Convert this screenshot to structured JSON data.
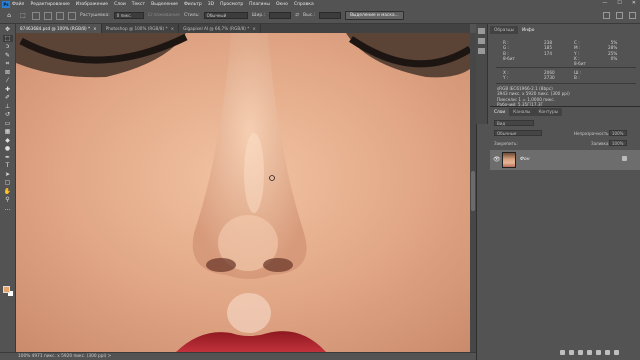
{
  "app": {
    "logo": "Ps"
  },
  "menu": [
    "Файл",
    "Редактирование",
    "Изображение",
    "Слои",
    "Текст",
    "Выделение",
    "Фильтр",
    "3D",
    "Просмотр",
    "Плагины",
    "Окно",
    "Справка"
  ],
  "window_controls": {
    "minimize": "—",
    "maximize": "☐",
    "close": "✕"
  },
  "options": {
    "feather_label": "Растушевка:",
    "feather_value": "0 пикс.",
    "antialias_label": "Сглаживание",
    "style_label": "Стиль:",
    "style_value": "Обычный",
    "width_label": "Шир.:",
    "height_label": "Выс.:",
    "select_mask_button": "Выделение и маска..."
  },
  "tabs": [
    {
      "label": "87463684.psd @ 100% (RGB/8) *",
      "close": "×"
    },
    {
      "label": "Photoshop @ 100% (RGB/8) *",
      "close": "×"
    },
    {
      "label": "Gigapixel AI @ 66,7% (RGB/8) *",
      "close": "×"
    }
  ],
  "info_panel": {
    "tabs": [
      "Образцы",
      "Инфо"
    ],
    "rgb_block": "R :\nG :\nB :\n8-бит",
    "rgb_vals": "238\n185\n174",
    "cmyk_block": "C :\nM :\nY :\nK :\n8-бит",
    "cmyk_vals": "5%\n28%\n25%\n0%",
    "xy_block": "X :\nY :",
    "xy_vals": "2060\n2730",
    "wh_block": "Ш :\nВ :",
    "doc_info": "sRGB IEC61966-2.1 (8bpc)\n3943 пикс. x 5920 пикс. (300 ppi)\nПиксели: 1 = 1,0000 пикс.\nРабочий: 5,35Г/17,3Г"
  },
  "layers_panel": {
    "tabs": [
      "Слои",
      "Каналы",
      "Контуры"
    ],
    "search_placeholder": "Вид",
    "blend_mode": "Обычные",
    "opacity_label": "Непрозрачность:",
    "opacity_value": "100%",
    "lock_label": "Закрепить:",
    "fill_label": "Заливка:",
    "fill_value": "100%",
    "layer_name": "Фон"
  },
  "status": {
    "text": "100%   4971 пикс. x 5920 пикс. (300 ppi)   >"
  },
  "colors": {
    "foreground": "#e4a46a",
    "background": "#ffffff"
  }
}
